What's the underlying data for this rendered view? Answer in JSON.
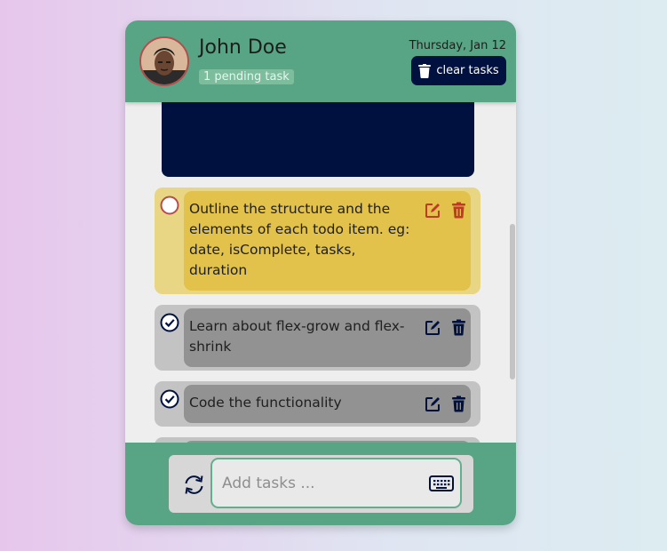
{
  "header": {
    "user_name": "John Doe",
    "pending_label": "1 pending task",
    "date": "Thursday, Jan 12",
    "clear_label": "clear tasks"
  },
  "todos": [
    {
      "text": "Outline the structure and the elements of each todo item. eg: date, isComplete, tasks, duration",
      "complete": false,
      "highlighted": true
    },
    {
      "text": "Learn about flex-grow and flex-shrink",
      "complete": true,
      "highlighted": false
    },
    {
      "text": "Code the functionality",
      "complete": true,
      "highlighted": false
    }
  ],
  "footer": {
    "input_placeholder": "Add tasks ...",
    "input_value": ""
  },
  "colors": {
    "accent": "#58a585",
    "navy": "#001140",
    "pending_bg": "#e8d684",
    "pending_inner": "#e2c24a",
    "pending_icon": "#c0392b",
    "done_bg": "#c3c3c3",
    "done_inner": "#929292"
  },
  "icons": {
    "clear": "trash-icon",
    "edit": "edit-icon",
    "delete": "trash-icon",
    "sync": "sync-icon",
    "keyboard": "keyboard-icon",
    "check": "check-circle-icon"
  }
}
